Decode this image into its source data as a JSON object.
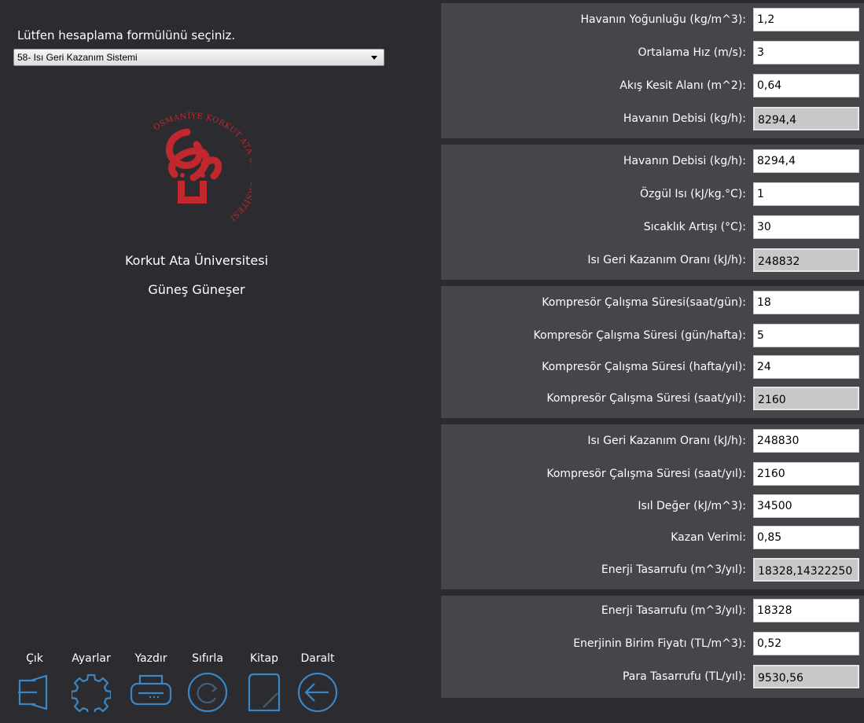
{
  "left": {
    "prompt": "Lütfen hesaplama formülünü seçiniz.",
    "selected_formula": "58- Isı Geri Kazanım Sistemi",
    "logo_ring_text": "OSMANİYE KORKUT ATA ÜNİVERSİTESİ",
    "university": "Korkut Ata Üniversitesi",
    "author": "Güneş Güneşer"
  },
  "toolbar": {
    "exit": "Çık",
    "settings": "Ayarlar",
    "print": "Yazdır",
    "reset": "Sıfırla",
    "book": "Kitap",
    "collapse": "Daralt"
  },
  "groups": [
    {
      "rows": [
        {
          "label": "Havanın Yoğunluğu (kg/m^3):",
          "value": "1,2"
        },
        {
          "label": "Ortalama Hız (m/s):",
          "value": "3"
        },
        {
          "label": "Akış Kesit Alanı (m^2):",
          "value": "0,64"
        },
        {
          "label": "Havanın Debisi (kg/h):",
          "value": "8294,4"
        }
      ]
    },
    {
      "rows": [
        {
          "label": "Havanın Debisi (kg/h):",
          "value": "8294,4"
        },
        {
          "label": "Özgül Isı (kJ/kg.°C):",
          "value": "1"
        },
        {
          "label": "Sıcaklık Artışı (°C):",
          "value": "30"
        },
        {
          "label": "Isı Geri Kazanım Oranı (kJ/h):",
          "value": "248832"
        }
      ]
    },
    {
      "rows": [
        {
          "label": "Kompresör Çalışma Süresi(saat/gün):",
          "value": "18"
        },
        {
          "label": "Kompresör Çalışma Süresi (gün/hafta):",
          "value": "5"
        },
        {
          "label": "Kompresör Çalışma Süresi (hafta/yıl):",
          "value": "24"
        },
        {
          "label": "Kompresör Çalışma Süresi (saat/yıl):",
          "value": "2160"
        }
      ]
    },
    {
      "rows": [
        {
          "label": "Isı Geri Kazanım Oranı (kJ/h):",
          "value": "248830"
        },
        {
          "label": "Kompresör Çalışma Süresi (saat/yıl):",
          "value": "2160"
        },
        {
          "label": "Isıl Değer (kJ/m^3):",
          "value": "34500"
        },
        {
          "label": "Kazan Verimi:",
          "value": "0,85"
        },
        {
          "label": "Enerji Tasarrufu (m^3/yıl):",
          "value": "18328,14322250"
        }
      ]
    },
    {
      "rows": [
        {
          "label": "Enerji Tasarrufu (m^3/yıl):",
          "value": "18328"
        },
        {
          "label": "Enerjinin Birim Fiyatı (TL/m^3):",
          "value": "0,52"
        },
        {
          "label": "Para Tasarrufu (TL/yıl):",
          "value": "9530,56"
        }
      ]
    }
  ],
  "colors": {
    "background": "#2b2b30",
    "panel": "#45454a",
    "icon": "#3b86c4",
    "logo": "#c0282d"
  }
}
